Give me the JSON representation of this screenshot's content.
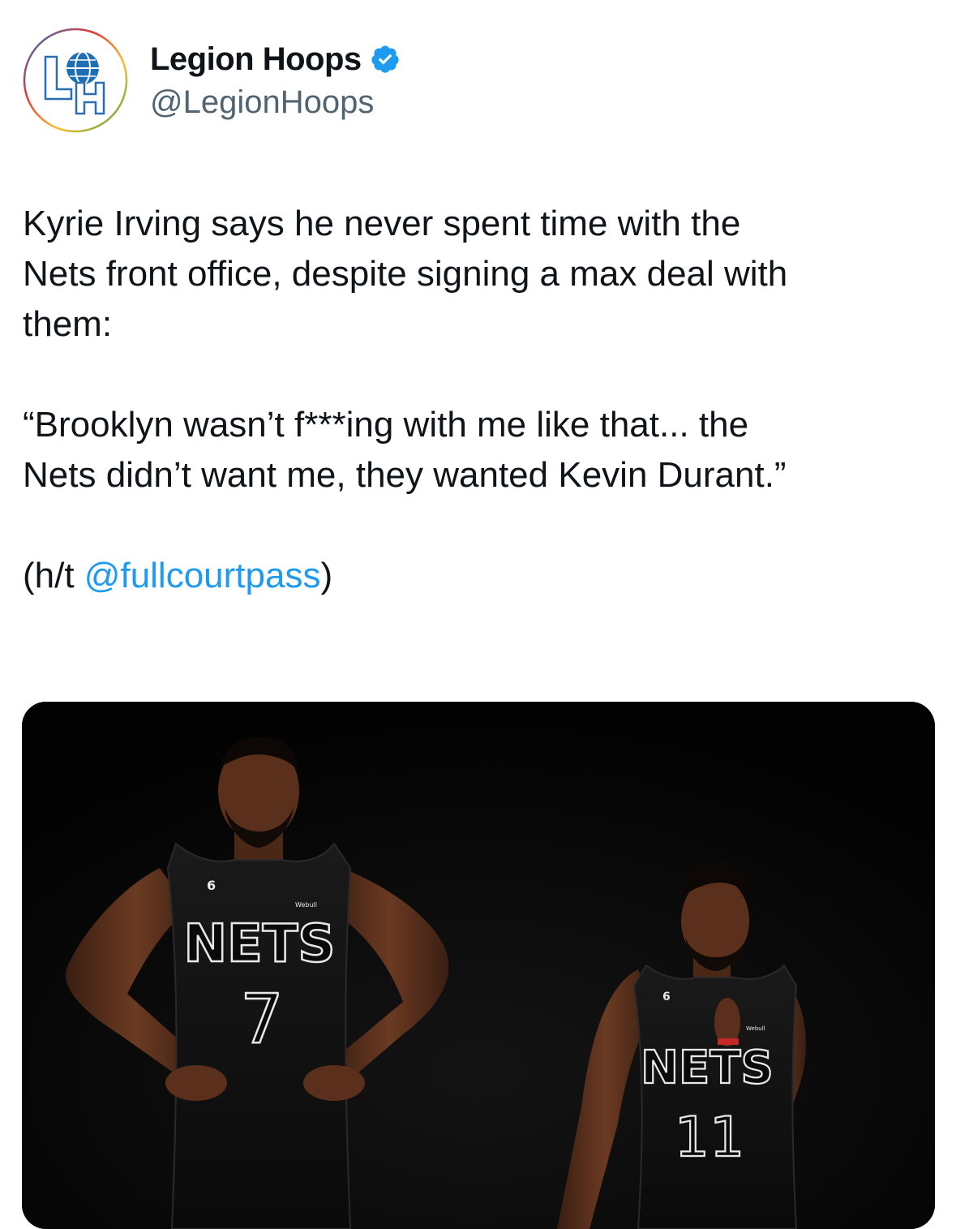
{
  "author": {
    "display_name": "Legion Hoops",
    "handle": "@LegionHoops",
    "verified": true,
    "avatar_icon": "legion-hoops-logo",
    "avatar_text": "LH"
  },
  "tweet": {
    "line1": "Kyrie Irving says he never spent time with the",
    "line2": "Nets front office, despite signing a max deal with",
    "line3": "them:",
    "quote_line1": "“Brooklyn wasn’t f***ing with me like that... the",
    "quote_line2": "Nets didn’t want me, they wanted Kevin Durant.”",
    "ht_prefix": "(h/t ",
    "ht_mention": "@fullcourtpass",
    "ht_suffix": ")"
  },
  "media": {
    "player_left": {
      "jersey_team": "NETS",
      "jersey_number": "7",
      "patch_number": "6",
      "sponsor": "Webull"
    },
    "player_right": {
      "jersey_team": "NETS",
      "jersey_number": "11",
      "patch_number": "6",
      "sponsor": "Webull"
    }
  },
  "colors": {
    "text": "#0f1419",
    "secondary": "#536471",
    "link": "#1d9bf0",
    "verified": "#1d9bf0",
    "media_bg": "#050505"
  }
}
